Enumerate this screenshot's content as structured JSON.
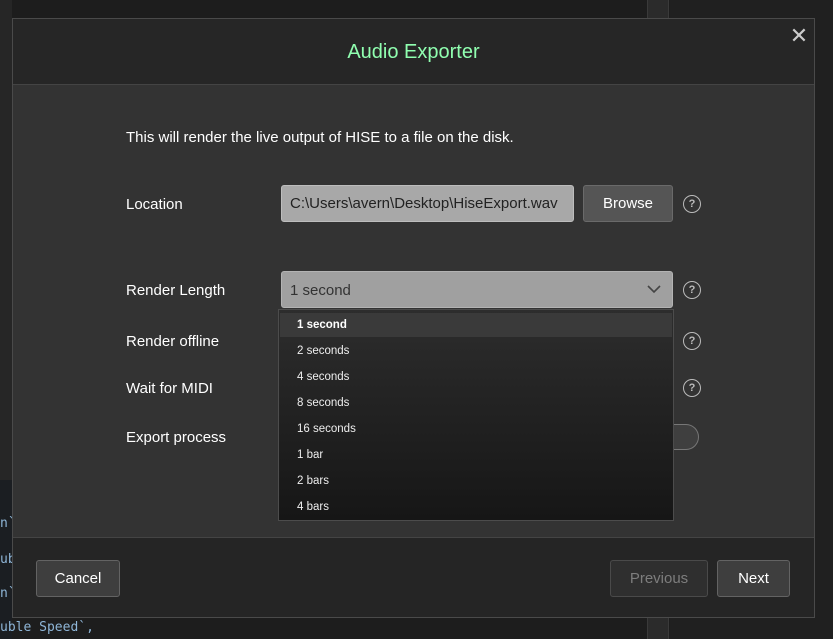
{
  "background": {
    "code_lines": [
      "n`",
      "ub",
      "n`",
      "uble Speed`,"
    ]
  },
  "dialog": {
    "title": "Audio Exporter",
    "title_color": "#90ffb0",
    "close_glyph": "✕",
    "intro": "This will render the live output of HISE to a file on the disk.",
    "location": {
      "label": "Location",
      "value": "C:\\Users\\avern\\Desktop\\HiseExport.wav",
      "browse_label": "Browse"
    },
    "render_length": {
      "label": "Render Length",
      "selected": "1 second",
      "options": [
        "1 second",
        "2 seconds",
        "4 seconds",
        "8 seconds",
        "16 seconds",
        "1 bar",
        "2 bars",
        "4 bars"
      ]
    },
    "render_offline": {
      "label": "Render offline"
    },
    "wait_for_midi": {
      "label": "Wait for MIDI"
    },
    "export_process": {
      "label": "Export process"
    },
    "help_glyph": "?",
    "footer": {
      "cancel_label": "Cancel",
      "previous_label": "Previous",
      "next_label": "Next"
    }
  }
}
